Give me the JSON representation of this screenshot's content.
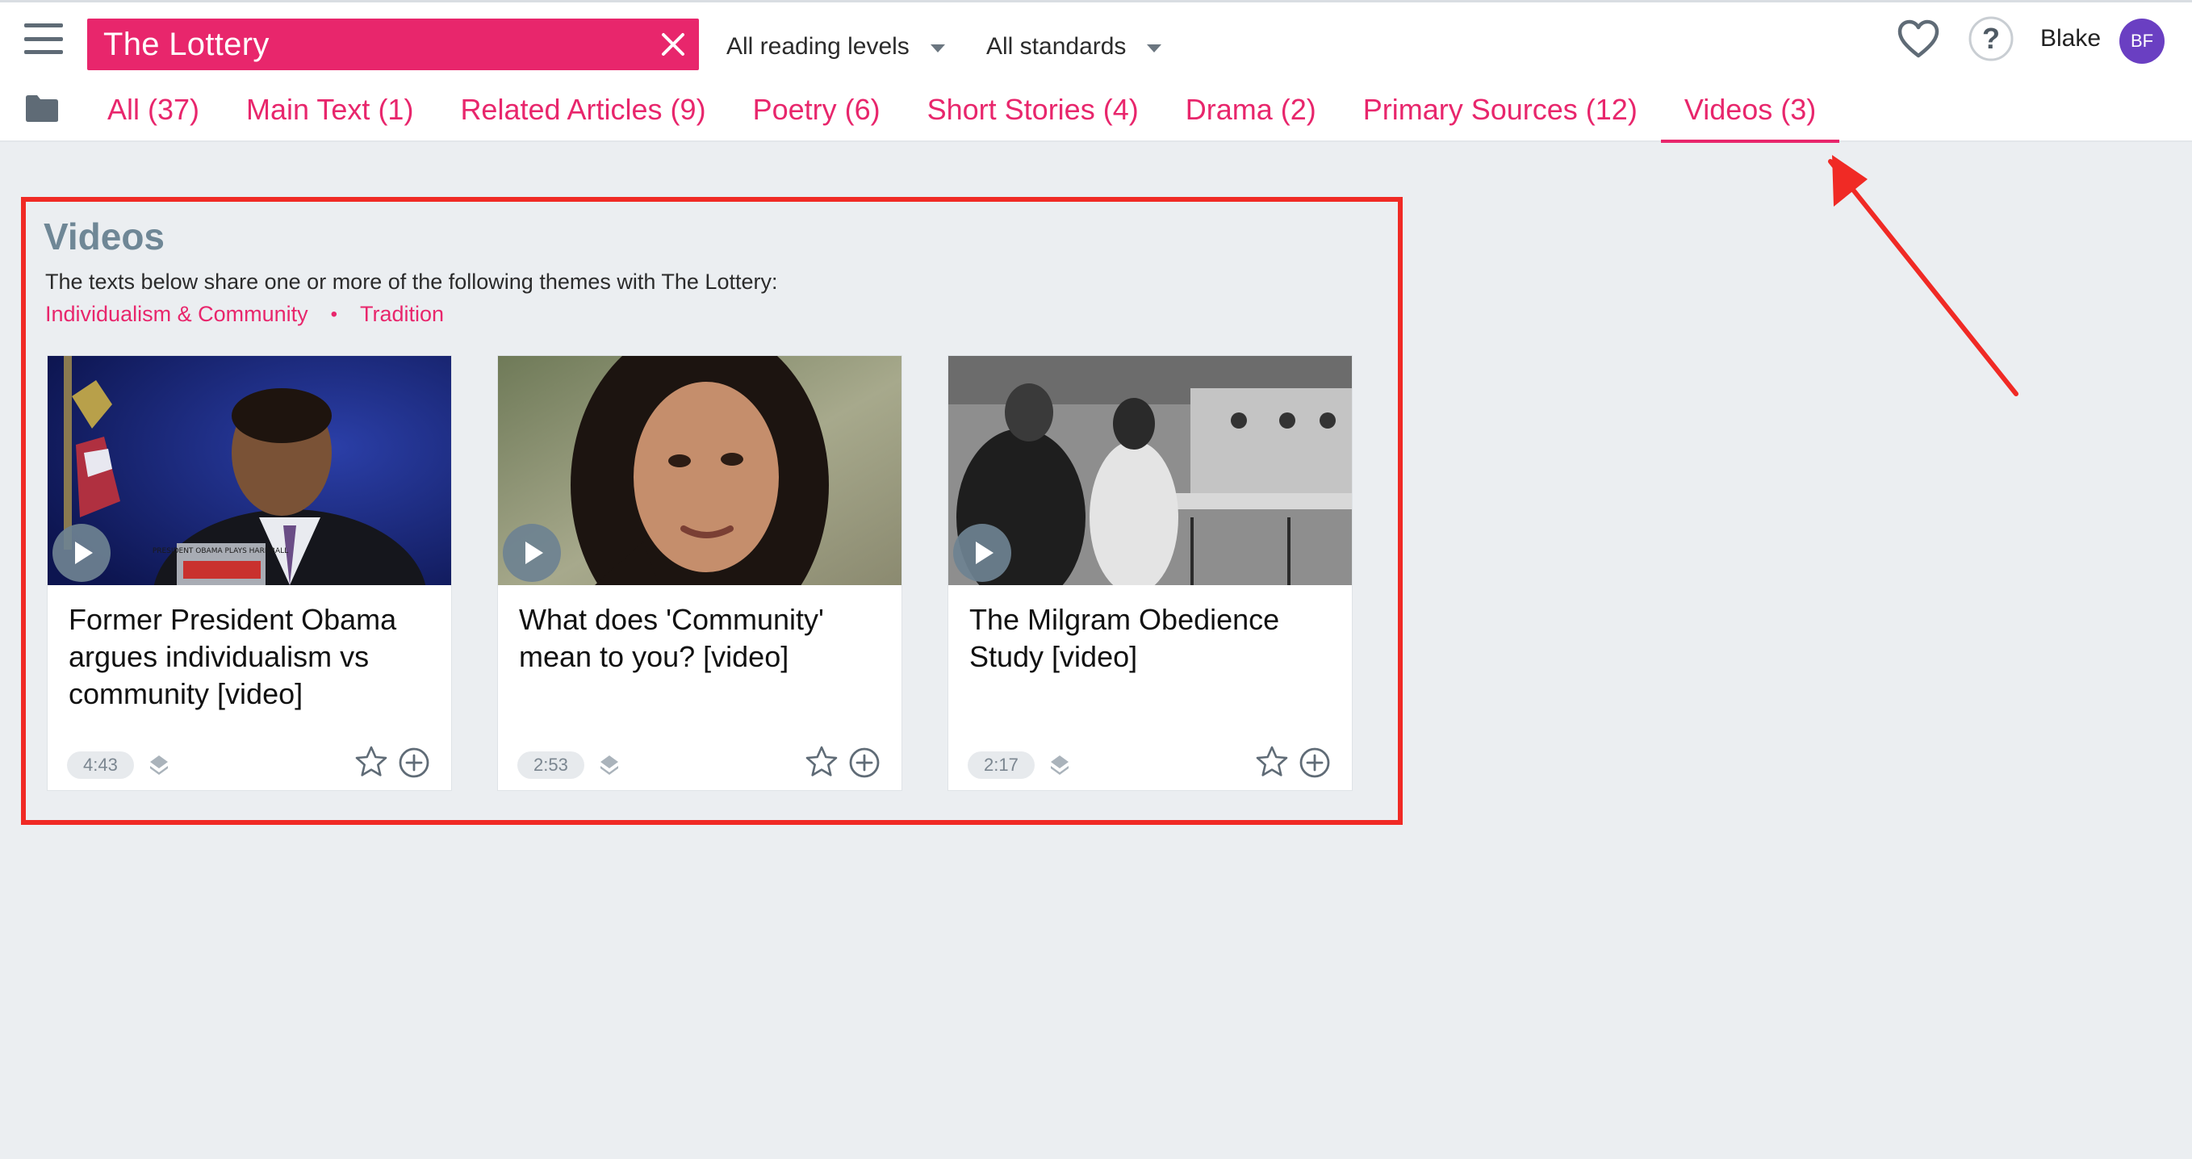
{
  "header": {
    "search_value": "The Lottery",
    "reading_levels": "All reading levels",
    "standards": "All standards",
    "user_name": "Blake",
    "avatar_initials": "BF"
  },
  "tabs": [
    {
      "label": "All (37)"
    },
    {
      "label": "Main Text (1)"
    },
    {
      "label": "Related Articles (9)"
    },
    {
      "label": "Poetry (6)"
    },
    {
      "label": "Short Stories (4)"
    },
    {
      "label": "Drama (2)"
    },
    {
      "label": "Primary Sources (12)"
    },
    {
      "label": "Videos (3)",
      "active": true
    }
  ],
  "section": {
    "title": "Videos",
    "description": "The texts below share one or more of the following themes with The Lottery:",
    "themes": [
      "Individualism & Community",
      "Tradition"
    ],
    "separator": "•"
  },
  "cards": [
    {
      "title": "Former President Obama argues individualism vs community [video]",
      "duration": "4:43",
      "thumb_text": "PRESIDENT OBAMA PLAYS HARDBALL"
    },
    {
      "title": "What does 'Community' mean to you? [video]",
      "duration": "2:53"
    },
    {
      "title": "The Milgram Obedience Study [video]",
      "duration": "2:17"
    }
  ],
  "colors": {
    "accent": "#e8266c",
    "annotation": "#f02a25",
    "avatar": "#6a3fc2",
    "section_title": "#6f8796"
  },
  "icons": [
    "menu-icon",
    "close-icon",
    "heart-icon",
    "help-icon",
    "folder-icon",
    "play-icon",
    "layers-icon",
    "star-icon",
    "plus-circle-icon"
  ]
}
